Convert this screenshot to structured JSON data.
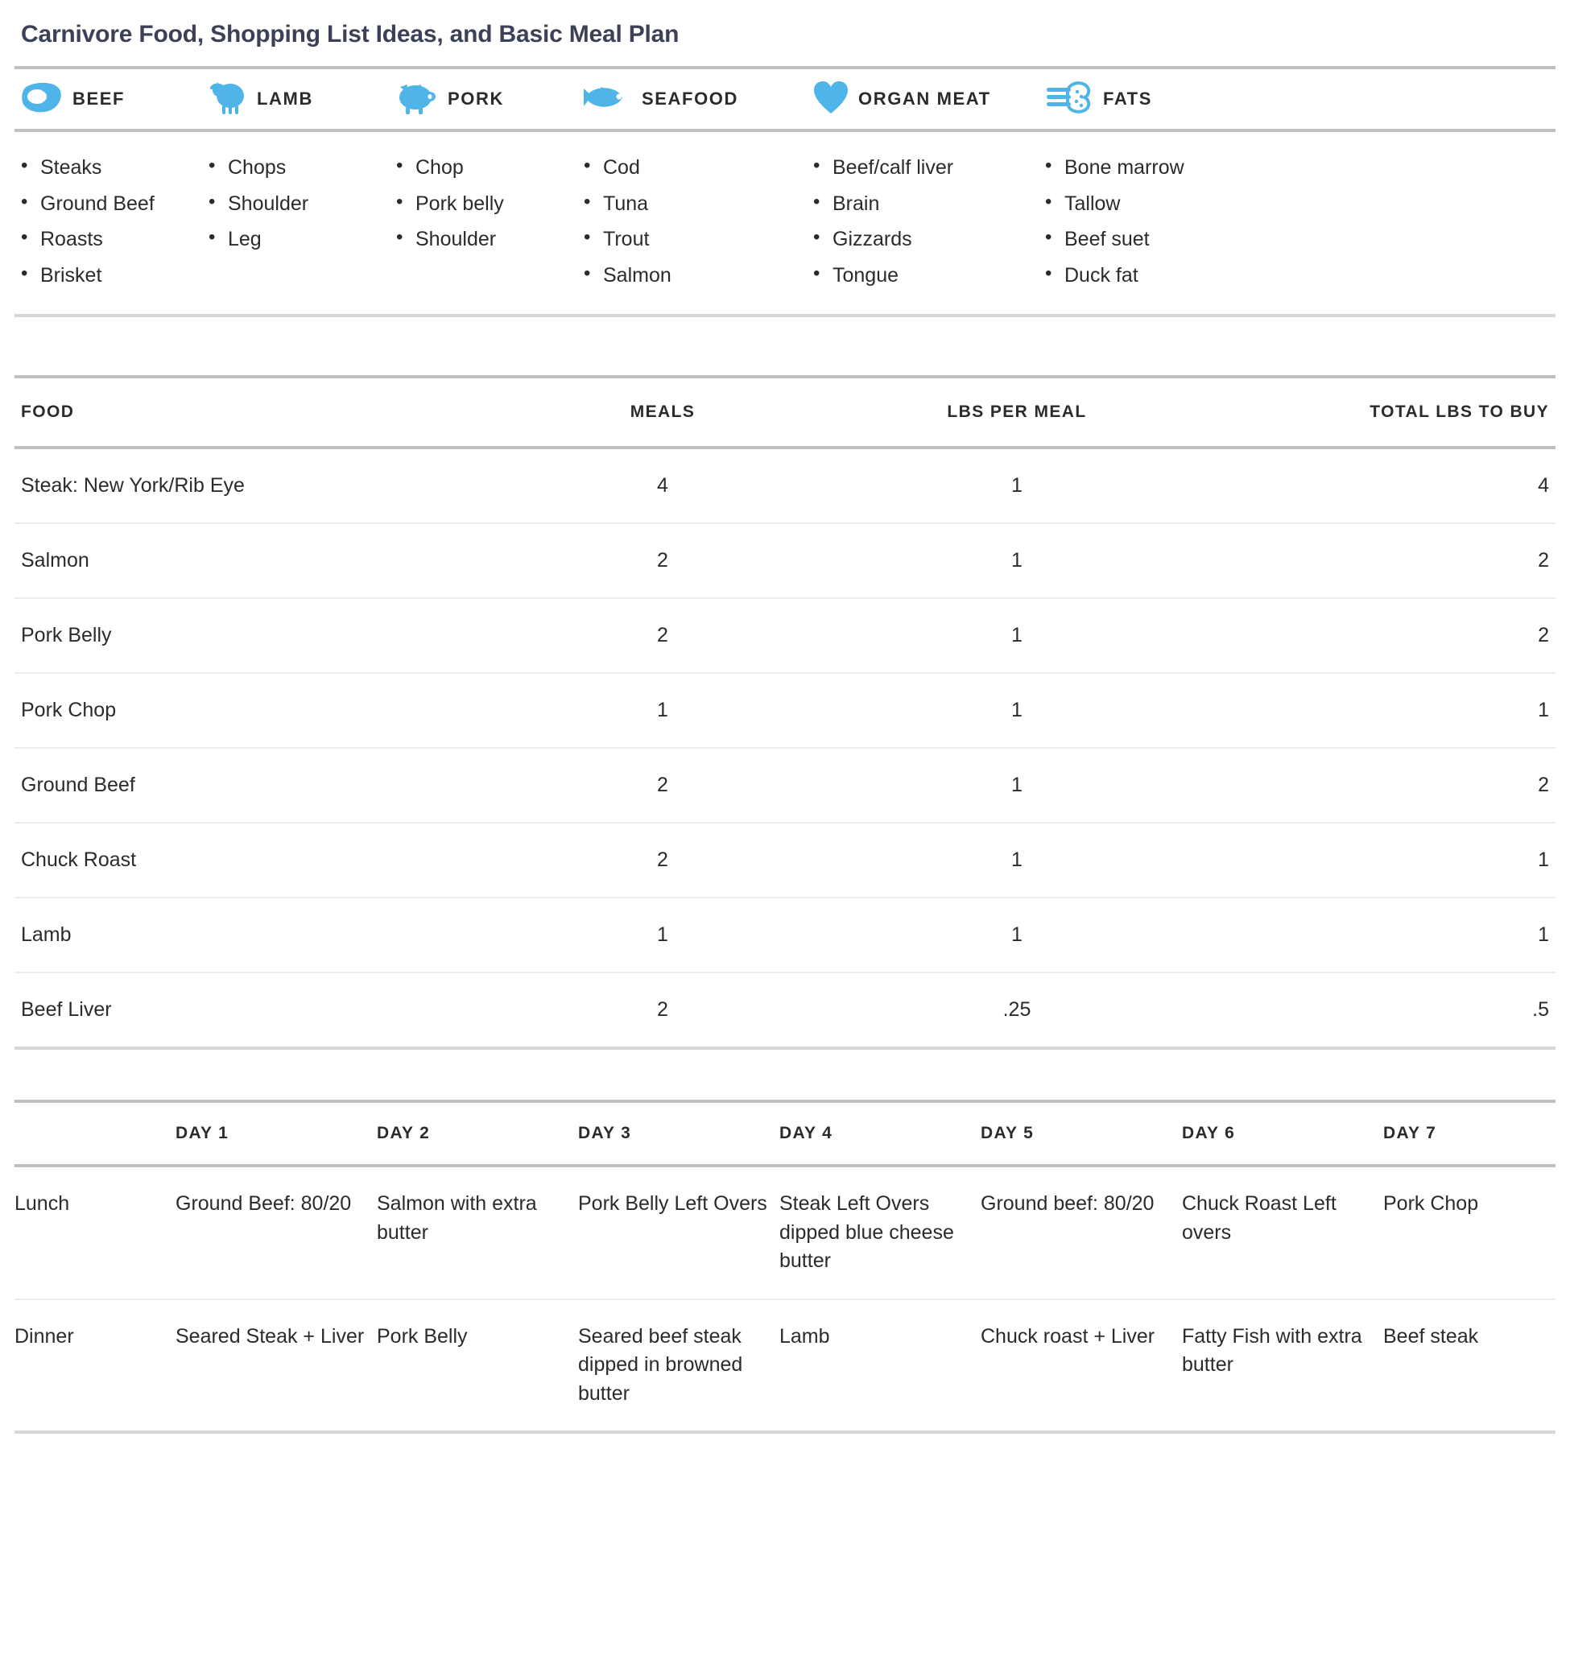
{
  "page": {
    "title": "Carnivore Food, Shopping List Ideas, and Basic Meal Plan",
    "accent_blue": "#4fb4e8",
    "title_color": "#3d4158",
    "text_color": "#2b2b2b",
    "rule_color": "#bfc0c2"
  },
  "categories": [
    {
      "label": "BEEF",
      "icon": "steak-icon",
      "items": [
        "Steaks",
        "Ground Beef",
        "Roasts",
        "Brisket"
      ]
    },
    {
      "label": "LAMB",
      "icon": "sheep-icon",
      "items": [
        "Chops",
        "Shoulder",
        "Leg"
      ]
    },
    {
      "label": "PORK",
      "icon": "pig-icon",
      "items": [
        "Chop",
        "Pork belly",
        "Shoulder"
      ]
    },
    {
      "label": "SEAFOOD",
      "icon": "fish-icon",
      "items": [
        "Cod",
        "Tuna",
        "Trout",
        "Salmon"
      ]
    },
    {
      "label": "ORGAN MEAT",
      "icon": "heart-icon",
      "items": [
        "Beef/calf liver",
        "Brain",
        "Gizzards",
        "Tongue"
      ]
    },
    {
      "label": "FATS",
      "icon": "bone-marrow-icon",
      "items": [
        "Bone marrow",
        "Tallow",
        "Beef suet",
        "Duck fat"
      ]
    }
  ],
  "shopping_table": {
    "headers": [
      "FOOD",
      "MEALS",
      "LBS PER MEAL",
      "TOTAL LBS TO BUY"
    ],
    "rows": [
      {
        "food": "Steak: New York/Rib Eye",
        "meals": "4",
        "lbs_per_meal": "1",
        "total_lbs": "4"
      },
      {
        "food": "Salmon",
        "meals": "2",
        "lbs_per_meal": "1",
        "total_lbs": "2"
      },
      {
        "food": "Pork Belly",
        "meals": "2",
        "lbs_per_meal": "1",
        "total_lbs": "2"
      },
      {
        "food": "Pork Chop",
        "meals": "1",
        "lbs_per_meal": "1",
        "total_lbs": "1"
      },
      {
        "food": "Ground Beef",
        "meals": "2",
        "lbs_per_meal": "1",
        "total_lbs": "2"
      },
      {
        "food": "Chuck Roast",
        "meals": "2",
        "lbs_per_meal": "1",
        "total_lbs": "1"
      },
      {
        "food": "Lamb",
        "meals": "1",
        "lbs_per_meal": "1",
        "total_lbs": "1"
      },
      {
        "food": "Beef Liver",
        "meals": "2",
        "lbs_per_meal": ".25",
        "total_lbs": ".5"
      }
    ]
  },
  "meal_plan": {
    "corner": "",
    "days": [
      "DAY 1",
      "DAY 2",
      "DAY 3",
      "DAY 4",
      "DAY 5",
      "DAY 6",
      "DAY 7"
    ],
    "rows": [
      {
        "label": "Lunch",
        "meals": [
          "Ground Beef: 80/20",
          "Salmon with extra butter",
          "Pork Belly Left Overs",
          "Steak Left Overs dipped blue cheese butter",
          "Ground beef: 80/20",
          "Chuck Roast Left overs",
          "Pork Chop"
        ]
      },
      {
        "label": "Dinner",
        "meals": [
          "Seared Steak + Liver",
          "Pork Belly",
          "Seared beef steak dipped in browned butter",
          "Lamb",
          "Chuck roast + Liver",
          "Fatty Fish with extra butter",
          "Beef steak"
        ]
      }
    ]
  }
}
